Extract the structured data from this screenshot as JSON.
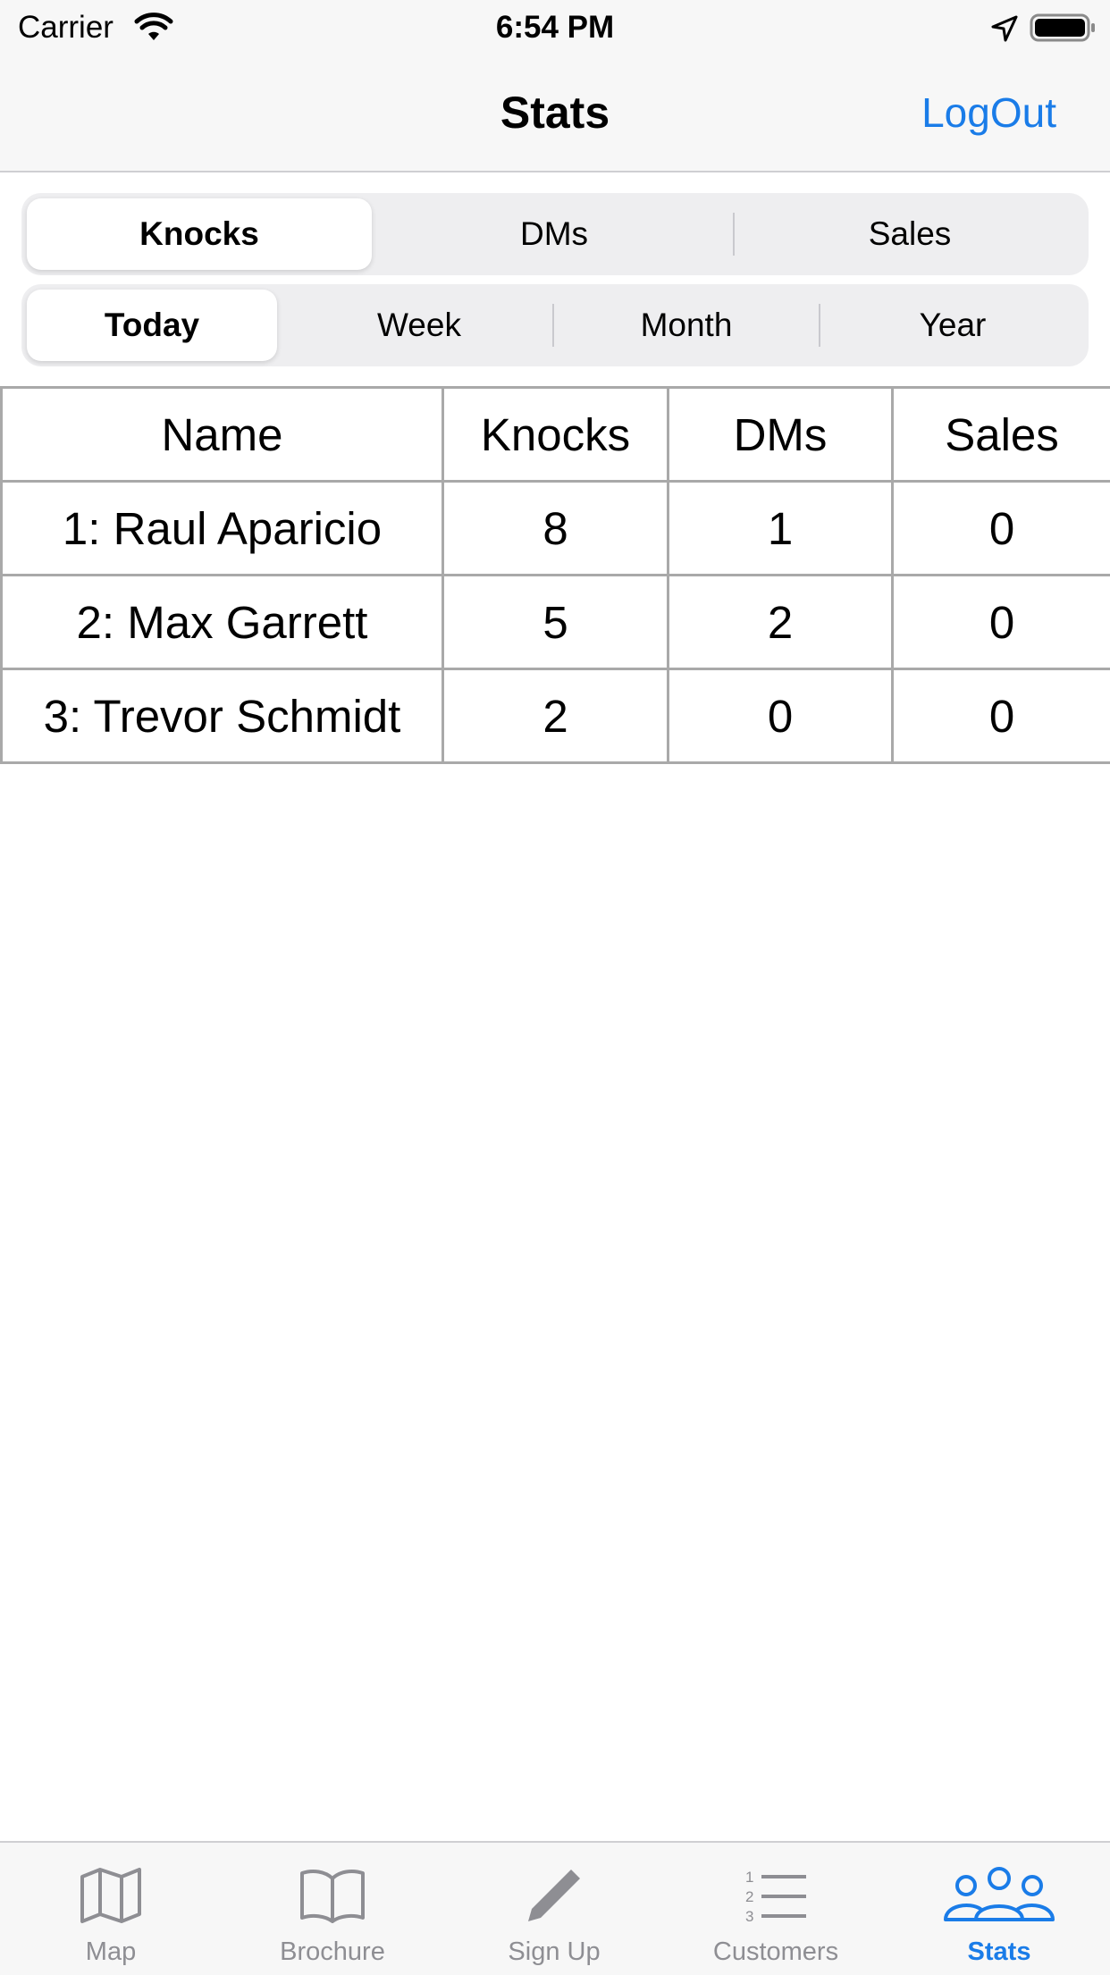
{
  "status_bar": {
    "carrier": "Carrier",
    "time": "6:54 PM",
    "icons": [
      "wifi-icon",
      "location-arrow-icon",
      "battery-icon"
    ]
  },
  "nav": {
    "title": "Stats",
    "logout_label": "LogOut"
  },
  "metric_segments": {
    "items": [
      "Knocks",
      "DMs",
      "Sales"
    ],
    "selected": "Knocks"
  },
  "period_segments": {
    "items": [
      "Today",
      "Week",
      "Month",
      "Year"
    ],
    "selected": "Today"
  },
  "table": {
    "headers": [
      "Name",
      "Knocks",
      "DMs",
      "Sales"
    ],
    "rows": [
      [
        "1: Raul Aparicio",
        "8",
        "1",
        "0"
      ],
      [
        "2: Max Garrett",
        "5",
        "2",
        "0"
      ],
      [
        "3: Trevor Schmidt",
        "2",
        "0",
        "0"
      ]
    ]
  },
  "tab_bar": {
    "tabs": [
      {
        "label": "Map",
        "icon": "map-icon"
      },
      {
        "label": "Brochure",
        "icon": "book-icon"
      },
      {
        "label": "Sign Up",
        "icon": "pencil-icon"
      },
      {
        "label": "Customers",
        "icon": "numbered-list-icon"
      },
      {
        "label": "Stats",
        "icon": "people-icon"
      }
    ],
    "active": "Stats"
  },
  "colors": {
    "accent": "#1a7ce8",
    "inactive_tab": "#8e8e93",
    "bar_background": "#f7f7f7",
    "table_border": "#a9a9a9"
  }
}
